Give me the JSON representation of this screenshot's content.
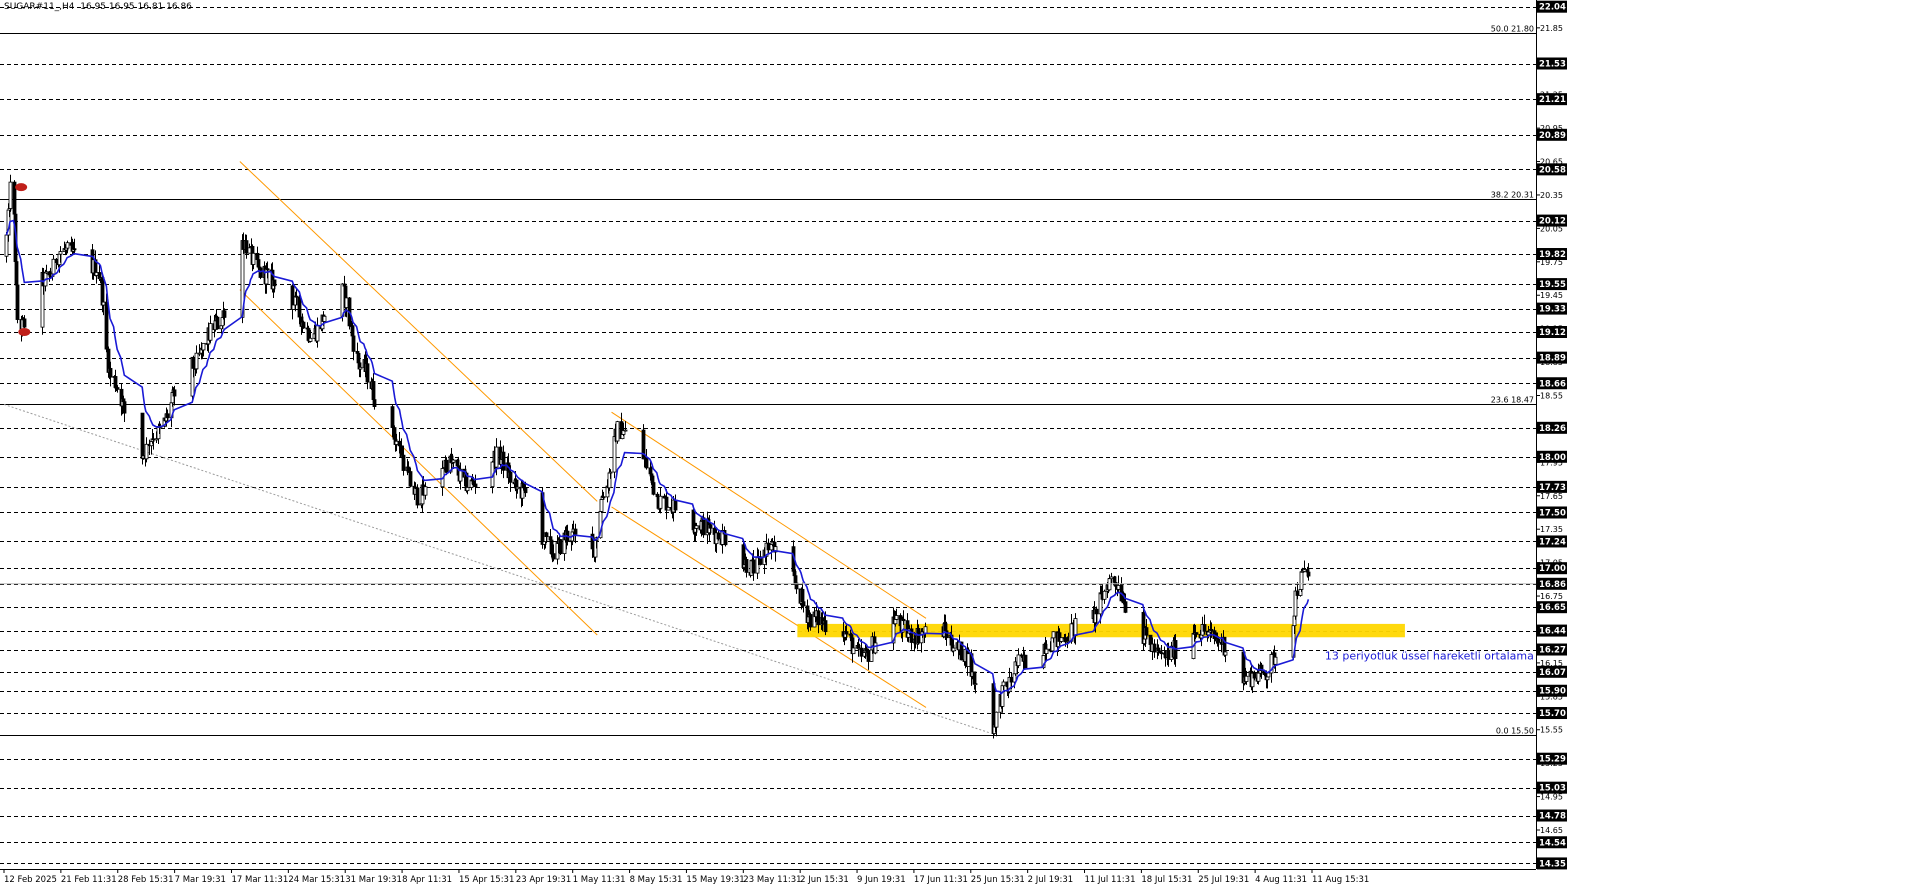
{
  "header": {
    "ticker_info": "SUGAR#11_,H4  16.95 16.95 16.81 16.86"
  },
  "colors": {
    "background": "#ffffff",
    "grid": "#000000",
    "candle": "#000000",
    "ema": "#1a1ad6",
    "channel": "#ff9900",
    "support_zone": "#ffd700",
    "annotation": "#1a1ad6",
    "trend_line": "#9a9a9a",
    "marker": "#c0201a",
    "price_label_bg": "#000000",
    "price_label_text": "#ffffff"
  },
  "chart_data": {
    "type": "candlestick",
    "symbol": "SUGAR#11_",
    "timeframe": "H4",
    "last_bar": {
      "open": 16.95,
      "high": 16.95,
      "low": 16.81,
      "close": 16.86
    },
    "x_tick_labels": [
      "12 Feb 2025",
      "21 Feb 11:31",
      "28 Feb 15:31",
      "7 Mar 19:31",
      "17 Mar 11:31",
      "24 Mar 15:31",
      "31 Mar 19:31",
      "8 Apr 11:31",
      "15 Apr 15:31",
      "23 Apr 19:31",
      "1 May 11:31",
      "8 May 15:31",
      "15 May 19:31",
      "23 May 11:31",
      "2 Jun 15:31",
      "9 Jun 19:31",
      "17 Jun 11:31",
      "25 Jun 15:31",
      "2 Jul 19:31",
      "11 Jul 11:31",
      "18 Jul 15:31",
      "25 Jul 19:31",
      "4 Aug 11:31",
      "11 Aug 15:31"
    ],
    "y_range": [
      14.3,
      22.1
    ],
    "price_scale_labels": [
      "22.05",
      "21.85",
      "21.55",
      "21.25",
      "20.95",
      "20.65",
      "20.35",
      "20.05",
      "19.75",
      "19.45",
      "19.15",
      "18.85",
      "18.55",
      "18.25",
      "17.95",
      "17.65",
      "17.35",
      "17.05",
      "16.75",
      "16.45",
      "16.15",
      "15.85",
      "15.55",
      "15.25",
      "14.95",
      "14.65",
      "14.35"
    ],
    "level_labels": [
      "22.04",
      "21.53",
      "21.21",
      "20.89",
      "20.58",
      "20.12",
      "19.82",
      "19.55",
      "19.33",
      "19.12",
      "18.89",
      "18.66",
      "18.26",
      "18.00",
      "17.73",
      "17.50",
      "17.24",
      "17.00",
      "16.86",
      "16.65",
      "16.44",
      "16.27",
      "16.07",
      "15.90",
      "15.70",
      "15.29",
      "15.03",
      "14.78",
      "14.54",
      "14.35"
    ],
    "fibonacci_levels": [
      {
        "label": "50.0 21.80",
        "value": 21.8
      },
      {
        "label": "38.2 20.31",
        "value": 20.31
      },
      {
        "label": "23.6 18.47",
        "value": 18.47
      },
      {
        "label": "0.0 15.50",
        "value": 15.5
      }
    ],
    "support_zone": {
      "low": 16.38,
      "high": 16.5
    },
    "ema_period": 13,
    "annotation_text": "13 periyotluk üssel hareketli ortalama",
    "swings": [
      {
        "date": "2025-02-12",
        "price": 19.8
      },
      {
        "date": "2025-02-13",
        "price": 20.45
      },
      {
        "date": "2025-02-14",
        "price": 19.15
      },
      {
        "date": "2025-02-18",
        "price": 19.6
      },
      {
        "date": "2025-02-20",
        "price": 19.85
      },
      {
        "date": "2025-02-25",
        "price": 19.7
      },
      {
        "date": "2025-02-27",
        "price": 18.7
      },
      {
        "date": "2025-03-03",
        "price": 18.0
      },
      {
        "date": "2025-03-05",
        "price": 18.2
      },
      {
        "date": "2025-03-10",
        "price": 18.8
      },
      {
        "date": "2025-03-14",
        "price": 19.2
      },
      {
        "date": "2025-03-17",
        "price": 19.95
      },
      {
        "date": "2025-03-20",
        "price": 19.65
      },
      {
        "date": "2025-03-24",
        "price": 19.4
      },
      {
        "date": "2025-03-27",
        "price": 19.1
      },
      {
        "date": "2025-03-31",
        "price": 19.5
      },
      {
        "date": "2025-04-03",
        "price": 18.8
      },
      {
        "date": "2025-04-07",
        "price": 18.2
      },
      {
        "date": "2025-04-11",
        "price": 17.65
      },
      {
        "date": "2025-04-15",
        "price": 17.95
      },
      {
        "date": "2025-04-18",
        "price": 17.75
      },
      {
        "date": "2025-04-22",
        "price": 18.0
      },
      {
        "date": "2025-04-25",
        "price": 17.7
      },
      {
        "date": "2025-04-30",
        "price": 17.15
      },
      {
        "date": "2025-05-02",
        "price": 17.3
      },
      {
        "date": "2025-05-05",
        "price": 17.1
      },
      {
        "date": "2025-05-07",
        "price": 17.7
      },
      {
        "date": "2025-05-09",
        "price": 18.25
      },
      {
        "date": "2025-05-12",
        "price": 18.0
      },
      {
        "date": "2025-05-15",
        "price": 17.6
      },
      {
        "date": "2025-05-20",
        "price": 17.4
      },
      {
        "date": "2025-05-23",
        "price": 17.3
      },
      {
        "date": "2025-05-28",
        "price": 17.0
      },
      {
        "date": "2025-05-30",
        "price": 17.2
      },
      {
        "date": "2025-06-02",
        "price": 16.9
      },
      {
        "date": "2025-06-05",
        "price": 16.55
      },
      {
        "date": "2025-06-09",
        "price": 16.45
      },
      {
        "date": "2025-06-12",
        "price": 16.2
      },
      {
        "date": "2025-06-16",
        "price": 16.55
      },
      {
        "date": "2025-06-19",
        "price": 16.4
      },
      {
        "date": "2025-06-23",
        "price": 16.45
      },
      {
        "date": "2025-06-26",
        "price": 16.25
      },
      {
        "date": "2025-06-30",
        "price": 15.55
      },
      {
        "date": "2025-07-02",
        "price": 15.9
      },
      {
        "date": "2025-07-04",
        "price": 16.15
      },
      {
        "date": "2025-07-09",
        "price": 16.35
      },
      {
        "date": "2025-07-14",
        "price": 16.55
      },
      {
        "date": "2025-07-17",
        "price": 16.9
      },
      {
        "date": "2025-07-21",
        "price": 16.4
      },
      {
        "date": "2025-07-24",
        "price": 16.2
      },
      {
        "date": "2025-07-29",
        "price": 16.45
      },
      {
        "date": "2025-08-01",
        "price": 16.35
      },
      {
        "date": "2025-08-04",
        "price": 16.0
      },
      {
        "date": "2025-08-07",
        "price": 16.05
      },
      {
        "date": "2025-08-11",
        "price": 16.45
      },
      {
        "date": "2025-08-12",
        "price": 16.85
      },
      {
        "date": "2025-08-13",
        "price": 16.95
      }
    ]
  }
}
